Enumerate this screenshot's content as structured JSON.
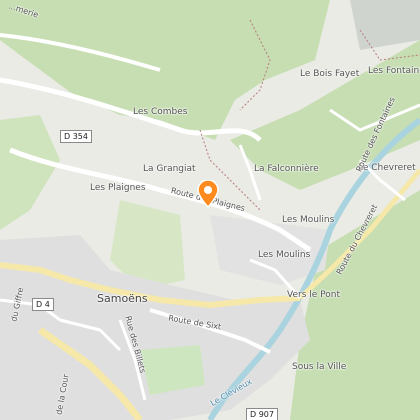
{
  "map": {
    "places": {
      "les_combes": "Les Combes",
      "le_bois_fayet": "Le Bois Fayet",
      "les_fontaines": "Les Fontaines",
      "la_grangiat": "La Grangiat",
      "la_falconniere": "La Falconnière",
      "les_plaignes": "Les Plaignes",
      "le_chevreret": "Le Chevreret",
      "les_moulins_north": "Les Moulins",
      "les_moulins_south": "Les Moulins",
      "samoens": "Samoëns",
      "vers_le_pont": "Vers le Pont",
      "sous_la_ville": "Sous la Ville"
    },
    "roads": {
      "route_des_plaignes": "Route des Plaignes",
      "route_de_sixt": "Route de Sixt",
      "rue_des_billets": "Rue des Billets",
      "route_des_fontaines": "Route des Fontaines",
      "route_du_chevreret": "Route du Chevreret",
      "rue_de_la_cour": "de la Cour",
      "rue_du_giffre": "du Giffre",
      "road_top_left": "...merie"
    },
    "river": "Le Clévieux",
    "shields": {
      "d354": "D 354",
      "d4": "D 4",
      "d907": "D 907"
    },
    "colors": {
      "forest": "#c6deb2",
      "built": "#e0dfdf",
      "road": "#ffffff",
      "major_road": "#f5e8a8",
      "water": "#a9d3df",
      "marker": "#ff8a1e"
    },
    "marker_icon": "map-pin-icon"
  }
}
